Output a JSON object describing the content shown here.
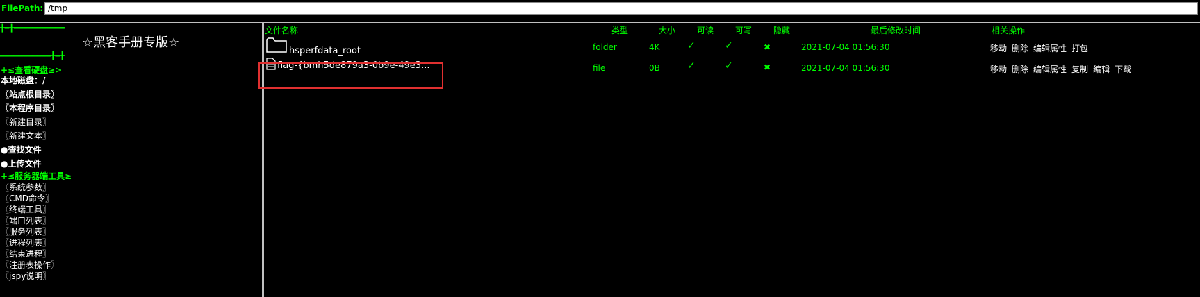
{
  "pathbar": {
    "label": "FilePath:",
    "value": "/tmp"
  },
  "sidebar": {
    "deco_top": "╋═╋═══════════",
    "title": "☆黑客手册专版☆",
    "deco_bottom": "═══════════╋═╋",
    "disk_section": "+≤查看硬盘≥>",
    "local_disk": "本地磁盘：/",
    "items_a": [
      "〖站点根目录〗",
      "〖本程序目录〗",
      "〖新建目录〗",
      "〖新建文本〗"
    ],
    "items_b": [
      "●查找文件",
      "●上传文件"
    ],
    "server_section": "+≤服务器端工具≥",
    "tools": [
      "〖系统参数〗",
      "〖CMD命令〗",
      "〖终端工具〗",
      "〖端口列表〗",
      "〖服务列表〗",
      "〖进程列表〗",
      "〖结束进程〗",
      "〖注册表操作〗",
      "〖jspy说明〗"
    ]
  },
  "table": {
    "headers": {
      "name": "文件名称",
      "type": "类型",
      "size": "大小",
      "readable": "可读",
      "writable": "可写",
      "hidden": "隐藏",
      "modified": "最后修改时间",
      "ops": "相关操作"
    },
    "rows": [
      {
        "icon": "folder-icon",
        "name": "hsperfdata_root",
        "type": "folder",
        "size": "4K",
        "readable": "✓",
        "writable": "✓",
        "hidden": "✖",
        "modified": "2021-07-04 01:56:30",
        "ops": [
          "移动",
          "删除",
          "编辑属性",
          "打包"
        ]
      },
      {
        "icon": "file-icon",
        "name": "flag-{bmh5de879a3-0b9e-49e3...",
        "type": "file",
        "size": "0B",
        "readable": "✓",
        "writable": "✓",
        "hidden": "✖",
        "modified": "2021-07-04 01:56:30",
        "ops": [
          "移动",
          "删除",
          "编辑属性",
          "复制",
          "编辑",
          "下载"
        ]
      }
    ]
  },
  "colors": {
    "accent": "#00ff00",
    "highlight_box": "#e03030",
    "rule": "#c0c0c0"
  }
}
